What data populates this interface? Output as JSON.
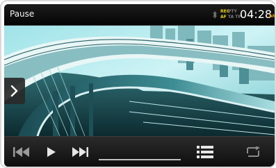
{
  "status_bar": {
    "title": "Pause",
    "time": "04:28",
    "ampm": "AM",
    "indicators": {
      "reg": "REG",
      "af": "AF",
      "pty": "PTY",
      "ta": "TA",
      "tp": "TP"
    },
    "bluetooth_icon": "bluetooth-icon"
  },
  "video": {
    "description_icon": "video-frame"
  },
  "side_panel": {
    "icon": "chevron-right-icon"
  },
  "controls": {
    "previous_icon": "skip-previous-icon",
    "play_icon": "play-icon",
    "next_icon": "skip-next-icon",
    "progress": 0,
    "list_icon": "list-icon",
    "repeat_icon": "repeat-icon"
  },
  "colors": {
    "status_bg": "#0a0a0a",
    "indicator_yellow": "#e8d000",
    "ampm_orange": "#e8a000",
    "icon_grey": "#9a9a9a",
    "icon_white": "#e6e6e6"
  }
}
